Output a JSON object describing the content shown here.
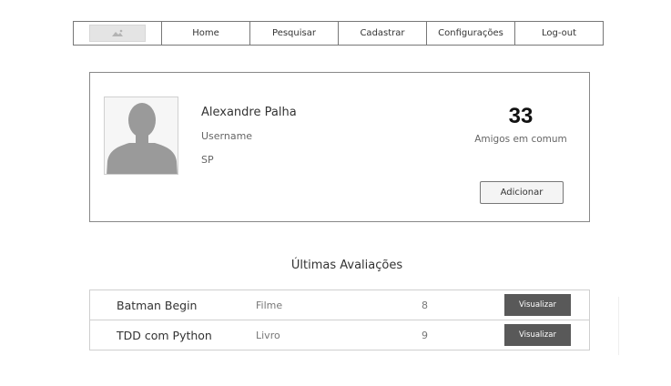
{
  "nav": {
    "logo_icon": "image-placeholder-icon",
    "items": [
      "Home",
      "Pesquisar",
      "Cadastrar",
      "Configurações",
      "Log-out"
    ]
  },
  "profile": {
    "avatar_icon": "user-silhouette-icon",
    "name": "Alexandre Palha",
    "username": "Username",
    "state": "SP",
    "friends_count": "33",
    "friends_label": "Amigos em comum",
    "add_button": "Adicionar"
  },
  "reviews": {
    "title": "Últimas Avaliações",
    "rows": [
      {
        "title": "Batman Begin",
        "type": "Filme",
        "score": "8",
        "action": "Visualizar"
      },
      {
        "title": "TDD com Python",
        "type": "Livro",
        "score": "9",
        "action": "Visualizar"
      }
    ]
  },
  "colors": {
    "border": "#777777",
    "button_dark": "#595959",
    "avatar_gray": "#9a9a9a"
  }
}
